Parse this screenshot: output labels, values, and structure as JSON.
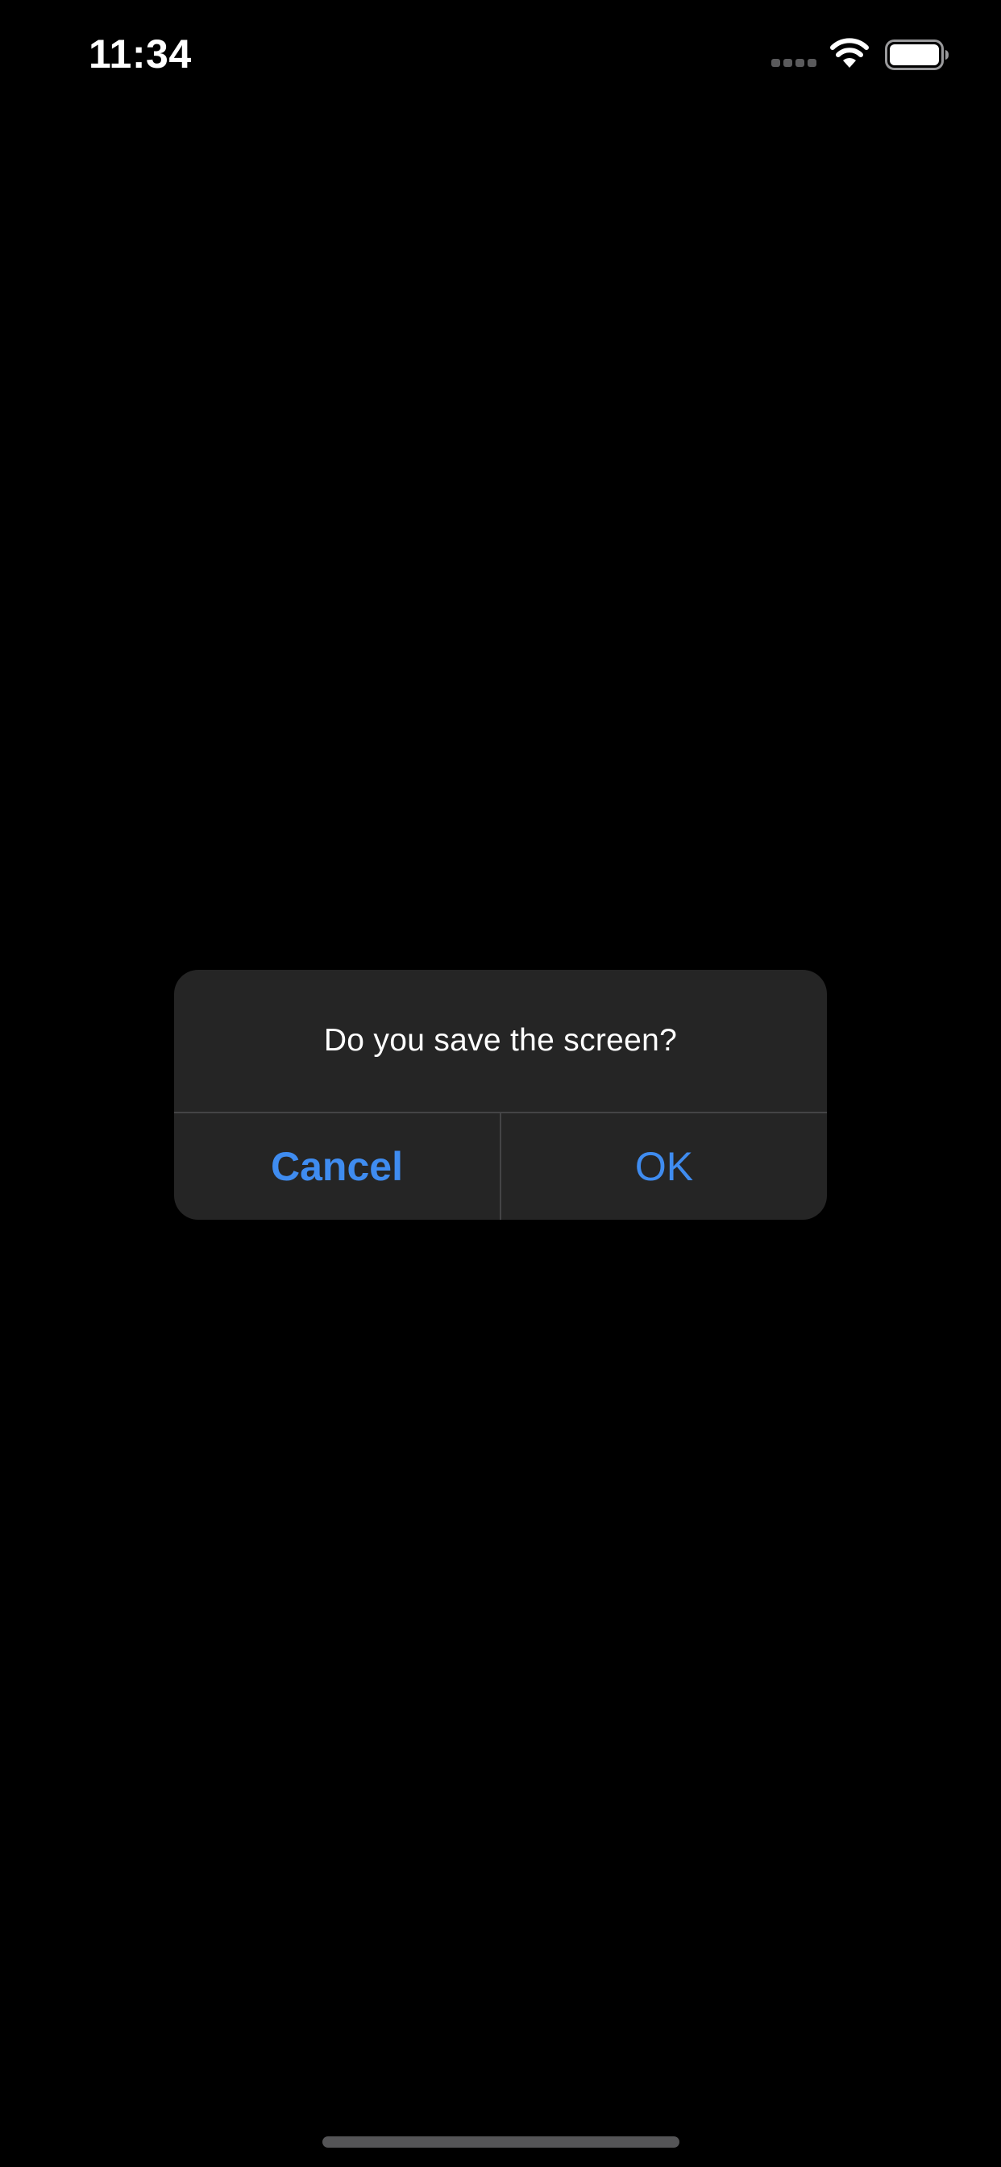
{
  "status_bar": {
    "time": "11:34",
    "icons": [
      "cellular-signal-icon",
      "wifi-icon",
      "battery-icon"
    ]
  },
  "alert": {
    "message": "Do you save the screen?",
    "cancel_label": "Cancel",
    "ok_label": "OK",
    "accent_color": "#3f8cf0",
    "background_color": "#252525"
  },
  "theme": {
    "background": "#000000",
    "text": "#ffffff"
  }
}
